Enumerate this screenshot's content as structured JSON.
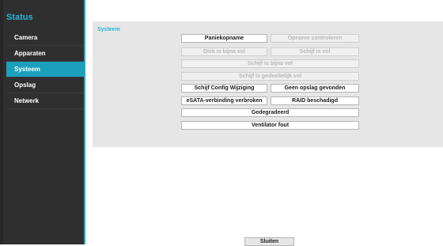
{
  "sidebar": {
    "title": "Status",
    "items": [
      {
        "label": "Camera"
      },
      {
        "label": "Apparaten"
      },
      {
        "label": "Systeem"
      },
      {
        "label": "Opslag"
      },
      {
        "label": "Netwerk"
      }
    ],
    "active_item": "Systeem"
  },
  "main": {
    "section_title": "Systeem",
    "events": {
      "paniek": {
        "label": "Paniekopname",
        "active": true
      },
      "opname_controleren": {
        "label": "Opname controleren",
        "active": false
      },
      "disk_bijna_vol": {
        "label": "Disk is bijna vol",
        "active": false
      },
      "schijf_vol": {
        "label": "Schijf is vol",
        "active": false
      },
      "schijf_bijna_vol": {
        "label": "Schijf is bijna vol",
        "active": false
      },
      "schijf_gedeeltelijk_vol": {
        "label": "Schijf is gedeeltelijk vol",
        "active": false
      },
      "schijf_config": {
        "label": "Schijf Config Wijziging",
        "active": true
      },
      "geen_opslag": {
        "label": "Geen opslag gevonden",
        "active": true
      },
      "esata": {
        "label": "eSATA-verbinding verbroken",
        "active": true
      },
      "raid": {
        "label": "RAID beschadigd",
        "active": true
      },
      "gedegradeerd": {
        "label": "Gedegradeerd",
        "active": true
      },
      "ventilator": {
        "label": "Ventilator fout",
        "active": true
      }
    }
  },
  "footer": {
    "close_label": "Sluiten"
  },
  "colors": {
    "accent": "#19a9c9",
    "sidebar_bg": "#2f2f2f",
    "panel_bg": "#e6e6e6"
  }
}
